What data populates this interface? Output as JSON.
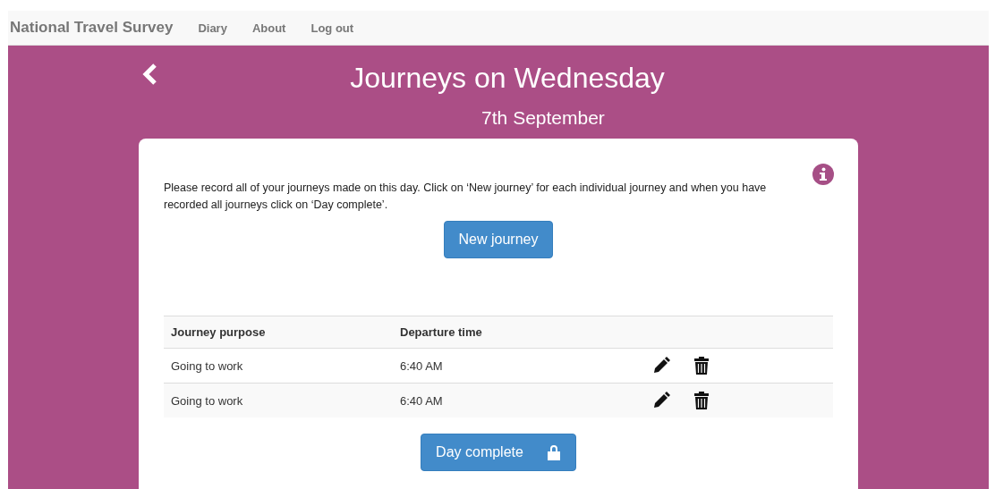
{
  "navbar": {
    "brand": "National Travel Survey",
    "links": [
      "Diary",
      "About",
      "Log out"
    ]
  },
  "header": {
    "title": "Journeys on Wednesday",
    "subtitle": "7th September"
  },
  "instructions": "Please record all of your journeys made on this day. Click on ‘New journey’ for each individual journey and when you have recorded all journeys click on ‘Day complete’.",
  "new_button": "New journey",
  "table": {
    "columns": [
      "Journey purpose",
      "Departure time"
    ],
    "rows": [
      {
        "purpose": "Going to work",
        "time": "6:40 AM"
      },
      {
        "purpose": "Going to work",
        "time": "6:40 AM"
      }
    ]
  },
  "complete_button": "Day complete"
}
